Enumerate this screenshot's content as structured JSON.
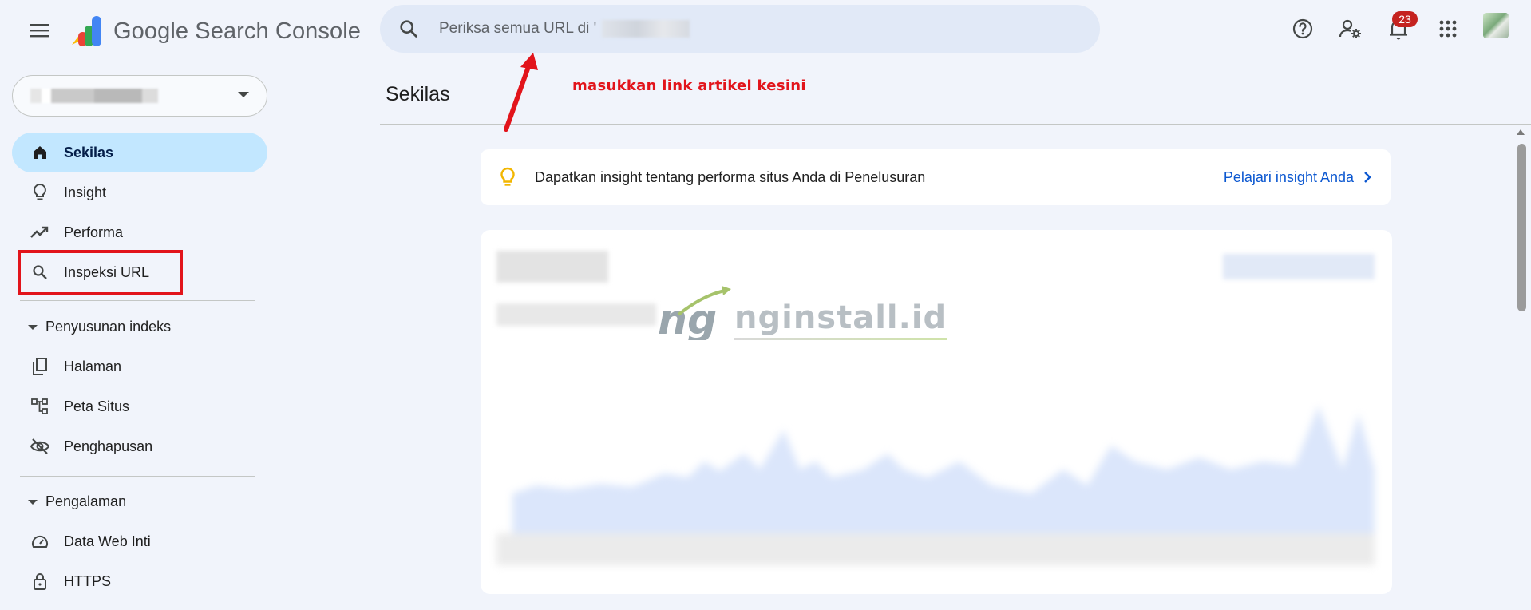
{
  "header": {
    "app_title": "Google Search Console",
    "search_placeholder": "Periksa semua URL di '",
    "notification_count": "23",
    "icons": [
      "menu-icon",
      "search-icon",
      "help-icon",
      "admin-settings-icon",
      "notifications-bell-icon",
      "apps-grid-icon"
    ]
  },
  "sidebar": {
    "items": [
      {
        "label": "Sekilas",
        "icon": "home-icon",
        "active": true
      },
      {
        "label": "Insight",
        "icon": "lightbulb-icon"
      },
      {
        "label": "Performa",
        "icon": "trending-up-icon"
      },
      {
        "label": "Inspeksi URL",
        "icon": "search-icon"
      }
    ],
    "sections": [
      {
        "label": "Penyusunan indeks",
        "items": [
          {
            "label": "Halaman",
            "icon": "pages-icon"
          },
          {
            "label": "Peta Situs",
            "icon": "sitemap-icon"
          },
          {
            "label": "Penghapusan",
            "icon": "removal-icon"
          }
        ]
      },
      {
        "label": "Pengalaman",
        "items": [
          {
            "label": "Data Web Inti",
            "icon": "speed-gauge-icon"
          },
          {
            "label": "HTTPS",
            "icon": "lock-icon"
          }
        ]
      }
    ]
  },
  "main": {
    "title": "Sekilas",
    "annotation": "masukkan link artikel kesini",
    "insight_text": "Dapatkan insight tentang performa situs Anda di Penelusuran",
    "insight_link": "Pelajari insight Anda"
  },
  "watermark": {
    "mark": "ng",
    "text": "nginstall.id"
  },
  "colors": {
    "accent_blue": "#0b57d0",
    "active_nav": "#c2e7ff",
    "annotation_red": "#e2141b",
    "badge_red": "#c5221f"
  }
}
